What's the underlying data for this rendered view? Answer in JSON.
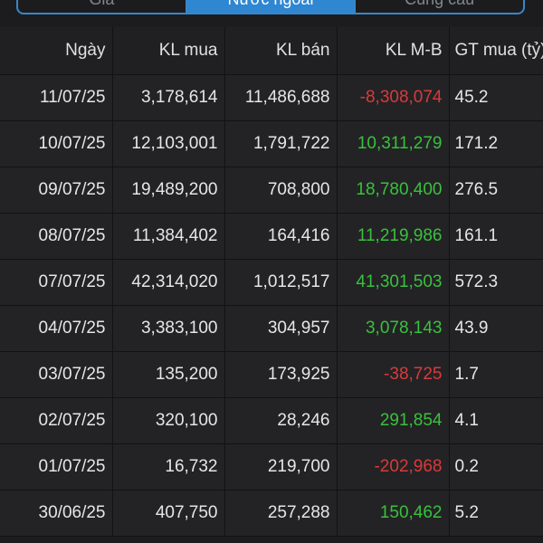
{
  "tabs": [
    {
      "label": "Giá",
      "active": false
    },
    {
      "label": "Nước ngoài",
      "active": true
    },
    {
      "label": "Cung cầu",
      "active": false
    }
  ],
  "table": {
    "headers": [
      "Ngày",
      "KL mua",
      "KL bán",
      "KL M-B",
      "GT mua (tỷ)"
    ],
    "rows": [
      {
        "date": "11/07/25",
        "buy_vol": "3,178,614",
        "sell_vol": "11,486,688",
        "net_vol": "-8,308,074",
        "net_sign": "neg",
        "buy_value": "45.2"
      },
      {
        "date": "10/07/25",
        "buy_vol": "12,103,001",
        "sell_vol": "1,791,722",
        "net_vol": "10,311,279",
        "net_sign": "pos",
        "buy_value": "171.2"
      },
      {
        "date": "09/07/25",
        "buy_vol": "19,489,200",
        "sell_vol": "708,800",
        "net_vol": "18,780,400",
        "net_sign": "pos",
        "buy_value": "276.5"
      },
      {
        "date": "08/07/25",
        "buy_vol": "11,384,402",
        "sell_vol": "164,416",
        "net_vol": "11,219,986",
        "net_sign": "pos",
        "buy_value": "161.1"
      },
      {
        "date": "07/07/25",
        "buy_vol": "42,314,020",
        "sell_vol": "1,012,517",
        "net_vol": "41,301,503",
        "net_sign": "pos",
        "buy_value": "572.3"
      },
      {
        "date": "04/07/25",
        "buy_vol": "3,383,100",
        "sell_vol": "304,957",
        "net_vol": "3,078,143",
        "net_sign": "pos",
        "buy_value": "43.9"
      },
      {
        "date": "03/07/25",
        "buy_vol": "135,200",
        "sell_vol": "173,925",
        "net_vol": "-38,725",
        "net_sign": "neg",
        "buy_value": "1.7"
      },
      {
        "date": "02/07/25",
        "buy_vol": "320,100",
        "sell_vol": "28,246",
        "net_vol": "291,854",
        "net_sign": "pos",
        "buy_value": "4.1"
      },
      {
        "date": "01/07/25",
        "buy_vol": "16,732",
        "sell_vol": "219,700",
        "net_vol": "-202,968",
        "net_sign": "neg",
        "buy_value": "0.2"
      },
      {
        "date": "30/06/25",
        "buy_vol": "407,750",
        "sell_vol": "257,288",
        "net_vol": "150,462",
        "net_sign": "pos",
        "buy_value": "5.2"
      }
    ]
  },
  "colors": {
    "positive": "#39c13d",
    "negative": "#d93a3a",
    "accent": "#2f86d1"
  }
}
